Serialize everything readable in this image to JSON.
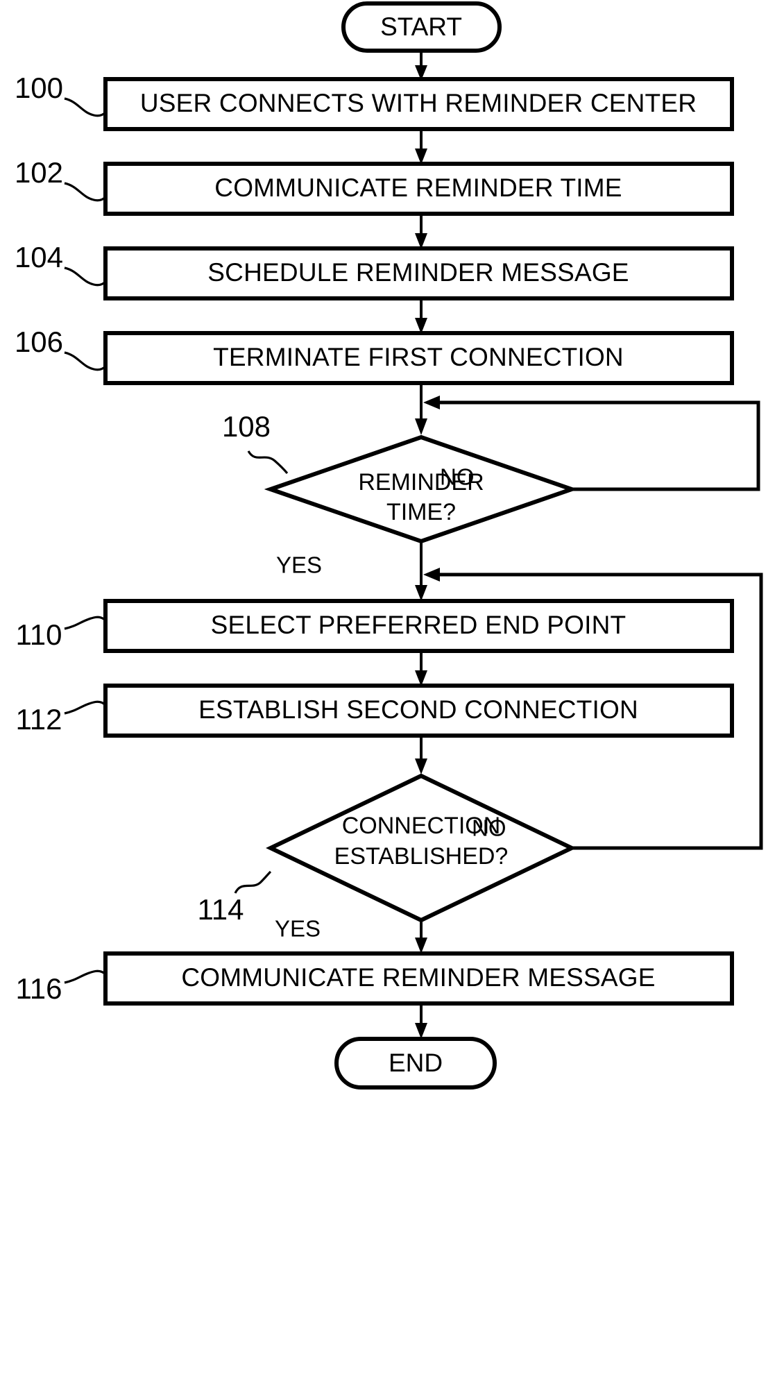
{
  "figure": {
    "type": "patent-flowchart",
    "title": "",
    "background_color": "#ffffff",
    "line_color": "#000000"
  },
  "terminals": {
    "start": {
      "label": "START",
      "ref": ""
    },
    "end": {
      "label": "END",
      "ref": ""
    }
  },
  "steps": [
    {
      "ref": "100",
      "label": "USER CONNECTS WITH REMINDER CENTER"
    },
    {
      "ref": "102",
      "label": "COMMUNICATE REMINDER TIME"
    },
    {
      "ref": "104",
      "label": "SCHEDULE REMINDER MESSAGE"
    },
    {
      "ref": "106",
      "label": "TERMINATE FIRST CONNECTION"
    },
    {
      "ref": "110",
      "label": "SELECT PREFERRED END POINT"
    },
    {
      "ref": "112",
      "label": "ESTABLISH SECOND CONNECTION"
    },
    {
      "ref": "116",
      "label": "COMMUNICATE REMINDER MESSAGE"
    }
  ],
  "decisions": [
    {
      "ref": "108",
      "line1": "REMINDER",
      "line2": "TIME?",
      "yes_label": "YES",
      "no_label": "NO"
    },
    {
      "ref": "114",
      "line1": "CONNECTION",
      "line2": "ESTABLISHED?",
      "yes_label": "YES",
      "no_label": "NO"
    }
  ]
}
